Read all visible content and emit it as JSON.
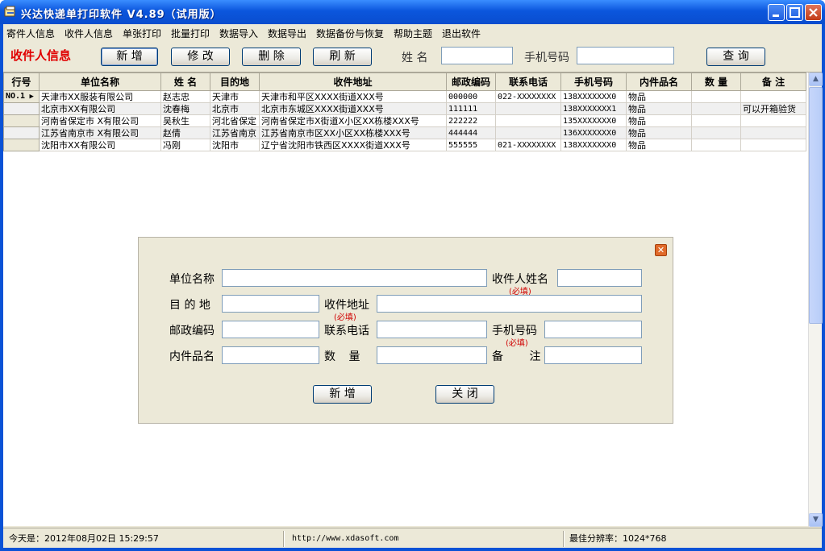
{
  "window": {
    "title": "兴达快递单打印软件 V4.89（试用版）"
  },
  "menu": [
    "寄件人信息",
    "收件人信息",
    "单张打印",
    "批量打印",
    "数据导入",
    "数据导出",
    "数据备份与恢复",
    "帮助主题",
    "退出软件"
  ],
  "toolbar": {
    "section_title": "收件人信息",
    "add": "新 增",
    "edit": "修 改",
    "delete": "删 除",
    "refresh": "刷 新",
    "name_label": "姓 名",
    "name_value": "",
    "phone_label": "手机号码",
    "phone_value": "",
    "query": "查 询"
  },
  "grid": {
    "columns": [
      "行号",
      "单位名称",
      "姓 名",
      "目的地",
      "收件地址",
      "邮政编码",
      "联系电话",
      "手机号码",
      "内件品名",
      "数 量",
      "备 注"
    ],
    "rows": [
      [
        "NO.1",
        "天津市XX服装有限公司",
        "赵志忠",
        "天津市",
        "天津市和平区XXXX街道XXX号",
        "000000",
        "022-XXXXXXXX",
        "138XXXXXXX0",
        "物品",
        "",
        ""
      ],
      [
        "",
        "北京市XX有限公司",
        "沈春梅",
        "北京市",
        "北京市东城区XXXX街道XXX号",
        "111111",
        "",
        "138XXXXXXX1",
        "物品",
        "",
        "可以开箱验货"
      ],
      [
        "",
        "河南省保定市 X有限公司",
        "吴秋生",
        "河北省保定",
        "河南省保定市X街道X小区XX栋楼XXX号",
        "222222",
        "",
        "135XXXXXXX0",
        "物品",
        "",
        ""
      ],
      [
        "",
        "江苏省南京市 X有限公司",
        "赵倩",
        "江苏省南京",
        "江苏省南京市区XX小区XX栋楼XXX号",
        "444444",
        "",
        "136XXXXXXX0",
        "物品",
        "",
        ""
      ],
      [
        "",
        "沈阳市XX有限公司",
        "冯刚",
        "沈阳市",
        "辽宁省沈阳市铁西区XXXX街道XXX号",
        "555555",
        "021-XXXXXXXX",
        "138XXXXXXX0",
        "物品",
        "",
        ""
      ]
    ]
  },
  "dialog": {
    "company_label": "单位名称",
    "company_value": "",
    "recipient_label": "收件人姓名",
    "recipient_req": "(必填)",
    "recipient_value": "",
    "dest_label": "目 的 地",
    "dest_value": "",
    "address_label": "收件地址",
    "address_req": "(必填)",
    "address_value": "",
    "postcode_label": "邮政编码",
    "postcode_value": "",
    "contact_label": "联系电话",
    "contact_value": "",
    "mobile_label": "手机号码",
    "mobile_req": "(必填)",
    "mobile_value": "",
    "item_label": "内件品名",
    "item_value": "",
    "qty_label": "数 量",
    "qty_value": "",
    "note_label": "备 注",
    "note_value": "",
    "add_button": "新 增",
    "close_button": "关 闭"
  },
  "status": {
    "today": "今天是：2012年08月02日  15:29:57",
    "url": "http://www.xdasoft.com",
    "resolution": "最佳分辨率：1024*768"
  },
  "colors": {
    "title_bar": "#0a52d6",
    "section_title": "#e00000",
    "required": "#d00000"
  }
}
